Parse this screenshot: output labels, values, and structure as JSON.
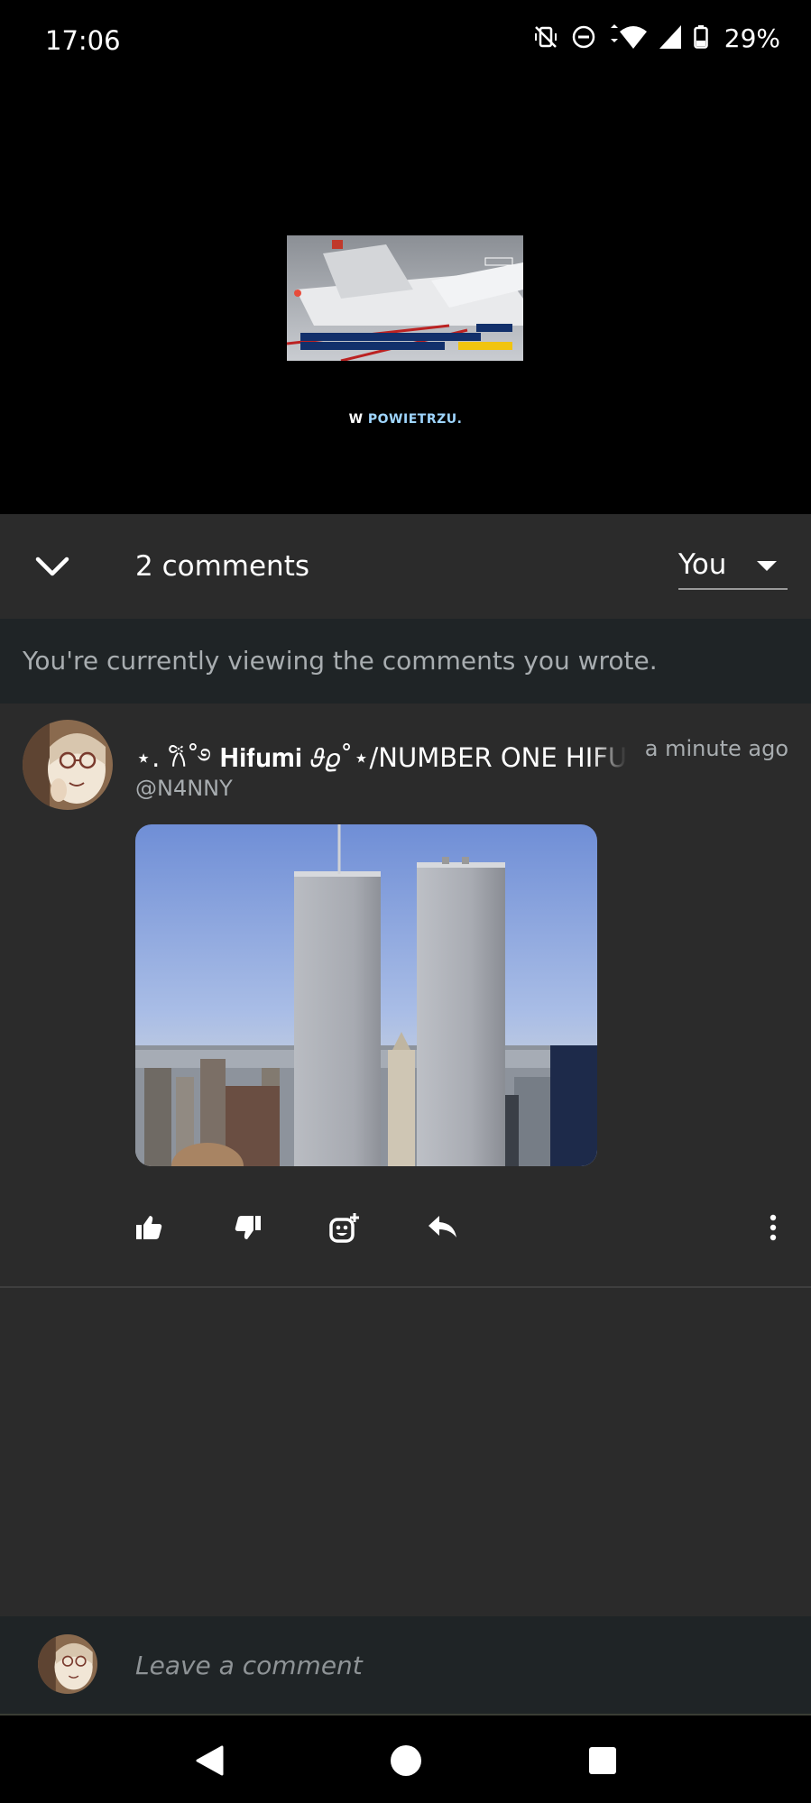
{
  "status_bar": {
    "time": "17:06",
    "battery_percent": "29%",
    "icons": [
      "vibrate-off-icon",
      "do-not-disturb-icon",
      "wifi-icon",
      "signal-icon",
      "battery-icon"
    ]
  },
  "video": {
    "caption_prefix": "W",
    "caption_main": "POWIETRZU."
  },
  "comments_header": {
    "count_label": "2 comments",
    "filter_value": "You"
  },
  "info_banner": {
    "text": "You're currently viewing the comments you wrote."
  },
  "comment": {
    "author": "⋆. 𐙚˚࿔ 𝐇𝐢𝐟𝐮𝐦𝐢 𝜗𝜚˚⋆/NUMBER ONE HIFUMI",
    "timestamp": "a minute ago",
    "handle": "@N4NNY",
    "actions": [
      "like-icon",
      "dislike-icon",
      "add-reaction-icon",
      "reply-icon",
      "more-options-icon"
    ]
  },
  "compose": {
    "placeholder": "Leave a comment"
  },
  "nav_bar": {
    "buttons": [
      "back-icon",
      "home-icon",
      "recents-icon"
    ]
  }
}
